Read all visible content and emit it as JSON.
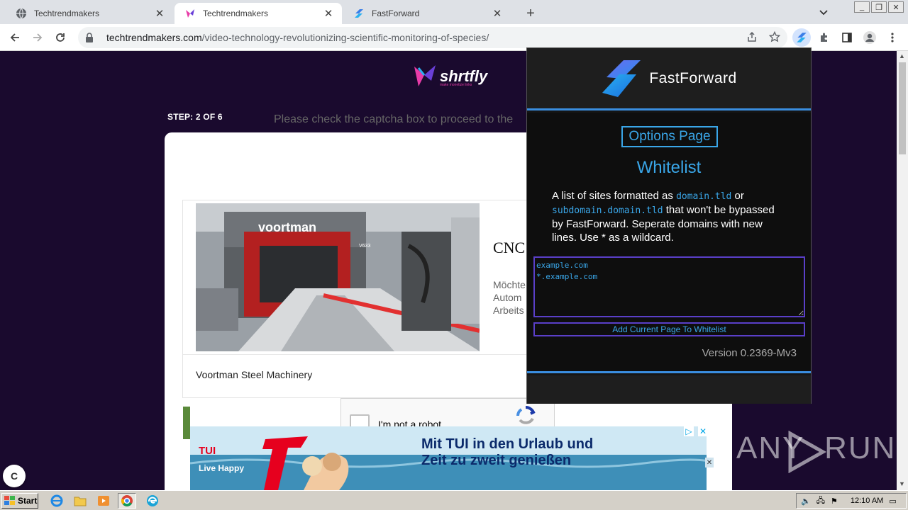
{
  "browser": {
    "tabs": [
      {
        "title": "Techtrendmakers",
        "active": false
      },
      {
        "title": "Techtrendmakers",
        "active": true
      },
      {
        "title": "FastForward",
        "active": false
      }
    ],
    "url_domain": "techtrendmakers.com",
    "url_path": "/video-technology-revolutionizing-scientific-monitoring-of-species/"
  },
  "page": {
    "logo_text": "shrtfly",
    "logo_tagline": "make monetize links",
    "step_label": "STEP: 2 OF 6",
    "captcha_message": "Please check the captcha box to proceed to the",
    "ad": {
      "image_brand": "voortman",
      "machine_label": "V633",
      "title": "CNC",
      "desc_lines": [
        "Möchte",
        "Autom",
        "Arbeits"
      ],
      "advertiser": "Voortman Steel Machinery"
    },
    "recaptcha_label": "I'm not a robot",
    "tui": {
      "logo": "TUI",
      "slogan": "Live Happy",
      "headline_1": "Mit TUI in den Urlaub und",
      "headline_2": "Zeit zu zweit genießen"
    },
    "bubble_letter": "C",
    "watermark": "ANY  RUN"
  },
  "fastforward": {
    "name": "FastForward",
    "options_label": "Options Page",
    "whitelist_heading": "Whitelist",
    "desc_pre": "A list of sites formatted as ",
    "desc_code1": "domain.tld",
    "desc_or": " or ",
    "desc_code2": "subdomain.domain.tld",
    "desc_post": " that won't be bypassed by FastForward. Seperate domains with new lines. Use * as a wildcard.",
    "whitelist_value": "example.com\n*.example.com",
    "add_button": "Add Current Page To Whitelist",
    "version": "Version 0.2369-Mv3",
    "accent": "#3aa6e8"
  },
  "taskbar": {
    "start_label": "Start",
    "clock": "12:10 AM"
  }
}
